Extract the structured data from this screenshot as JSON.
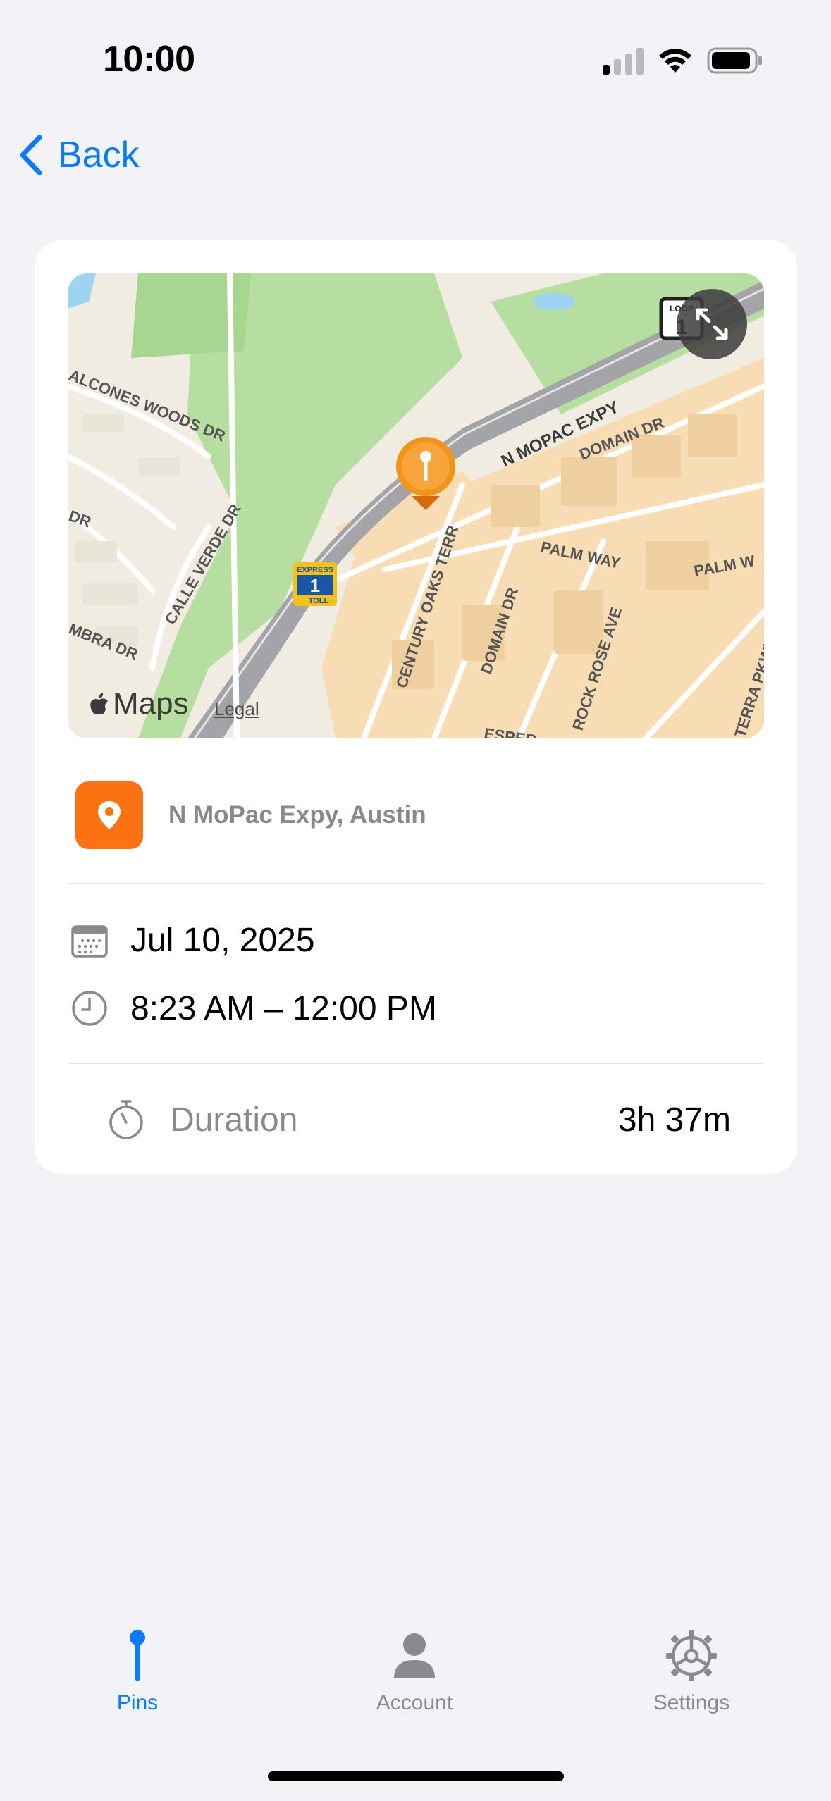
{
  "status_bar": {
    "time": "10:00"
  },
  "nav": {
    "back_label": "Back"
  },
  "map": {
    "attribution": "Maps",
    "legal": "Legal",
    "street_labels": [
      "N MOPAC EXPY",
      "DOMAIN DR",
      "PALM WAY",
      "PALM W",
      "CENTURY OAKS TERR",
      "ROCK ROSE AVE",
      "CALLE VERDE DR",
      "ALCONES WOODS DR",
      "MBRA DR",
      "DR",
      "TERRA PKWY",
      "ESPER"
    ],
    "shield_express": "EXPRESS",
    "shield_number": "1",
    "shield_toll": "TOLL",
    "shield_loop": "LOOP",
    "shield_loop_number": "1"
  },
  "location": {
    "name": "N MoPac Expy, Austin"
  },
  "visit": {
    "date": "Jul 10, 2025",
    "time_range": "8:23 AM – 12:00 PM",
    "duration_label": "Duration",
    "duration_value": "3h 37m"
  },
  "tabs": [
    {
      "label": "Pins",
      "active": true
    },
    {
      "label": "Account",
      "active": false
    },
    {
      "label": "Settings",
      "active": false
    }
  ],
  "colors": {
    "accent": "#0a7aff",
    "pin_orange": "#fa7212",
    "background": "#f2f2f7"
  }
}
